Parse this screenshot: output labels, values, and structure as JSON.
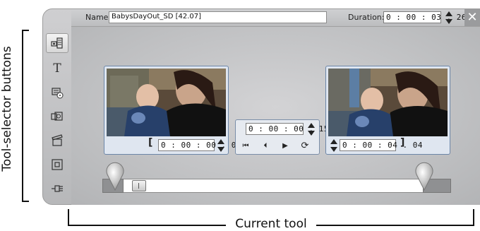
{
  "annotations": {
    "left_label": "Tool-selector buttons",
    "bottom_label": "Current tool"
  },
  "titlebar": {
    "name_label": "Name:",
    "name_value": "BabysDayOut_SD [42.07]",
    "duration_label": "Duration:",
    "duration_value": "0 : 00 : 03 . 26",
    "close_glyph": "✕"
  },
  "tools": [
    {
      "name": "clip-properties-tool-icon",
      "active": true
    },
    {
      "name": "title-tool-icon",
      "glyph": "T"
    },
    {
      "name": "disc-menu-tool-icon"
    },
    {
      "name": "transition-tool-icon"
    },
    {
      "name": "video-effects-tool-icon"
    },
    {
      "name": "picture-in-picture-tool-icon"
    },
    {
      "name": "chroma-key-tool-icon"
    }
  ],
  "trim": {
    "start_bracket": "[",
    "start_tc": "0 : 00 : 00 . 09",
    "current_tc": "0 : 00 : 00 . 15",
    "end_tc": "0 : 00 : 04 . 04",
    "end_bracket": "]",
    "transport": {
      "go_start": "⏮",
      "step_back": "⏴",
      "play": "▶",
      "loop": "⟳"
    }
  },
  "colors": {
    "frame_blue": "#6c86a8",
    "panel_bg": "#c6c7c9"
  }
}
